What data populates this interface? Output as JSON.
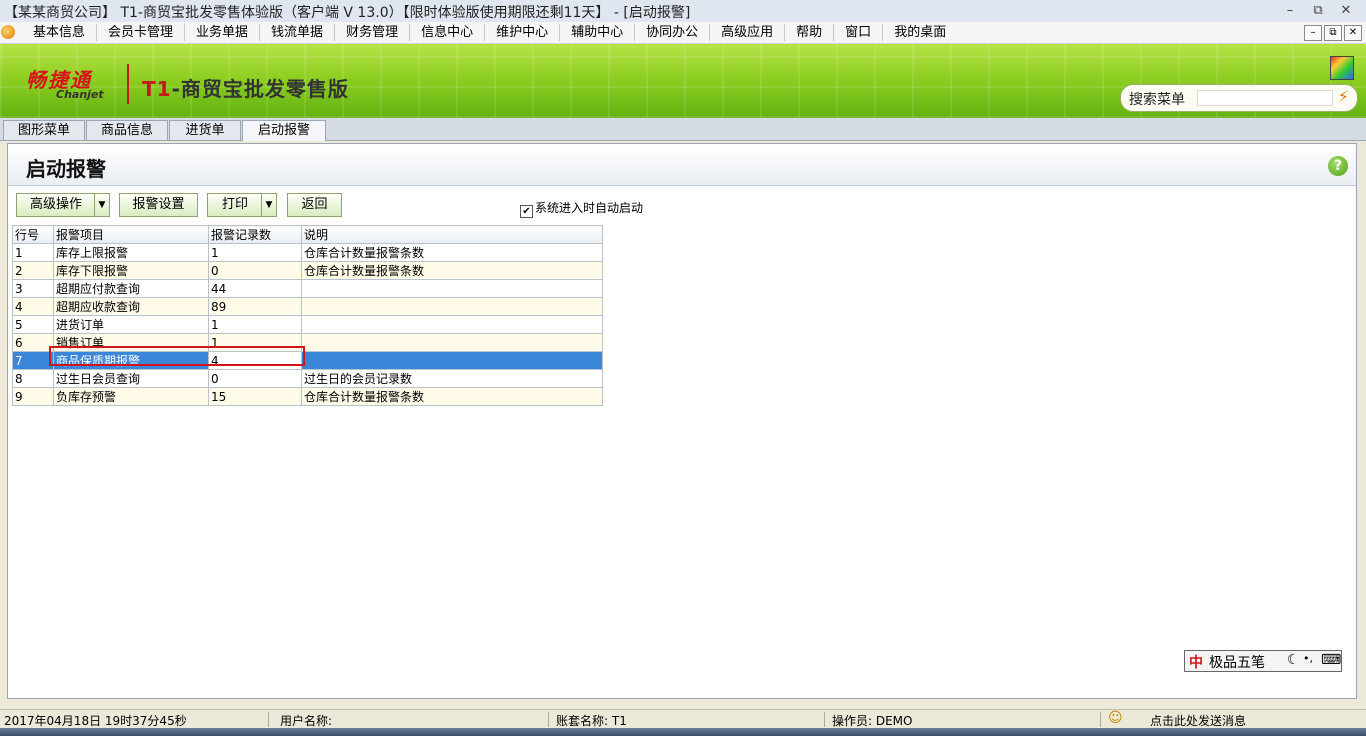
{
  "window": {
    "title": "【某某商贸公司】 T1-商贸宝批发零售体验版（客户端 V 13.0）【限时体验版使用期限还剩11天】 - [启动报警]",
    "min": "–",
    "restore": "⧉",
    "close": "✕"
  },
  "menu": {
    "items": [
      "基本信息",
      "会员卡管理",
      "业务单据",
      "钱流单据",
      "财务管理",
      "信息中心",
      "维护中心",
      "辅助中心",
      "协同办公",
      "高级应用",
      "帮助",
      "窗口",
      "我的桌面"
    ],
    "mdi": [
      "–",
      "⧉",
      "✕"
    ]
  },
  "banner": {
    "logo_cn": "畅捷通",
    "logo_en": "Chanjet",
    "product_t1": "T1",
    "product_rest": "-商贸宝批发零售版",
    "search_label": "搜索菜单",
    "search_value": ""
  },
  "tabs": [
    "图形菜单",
    "商品信息",
    "进货单",
    "启动报警"
  ],
  "page": {
    "title": "启动报警",
    "help": "?"
  },
  "toolbar": {
    "advanced": "高级操作",
    "alarm_settings": "报警设置",
    "print": "打印",
    "back": "返回",
    "auto_start_label": "系统进入时自动启动",
    "auto_start_checked": true,
    "check_mark": "✔",
    "dropdown_glyph": "▼"
  },
  "grid": {
    "columns": [
      "行号",
      "报警项目",
      "报警记录数",
      "说明"
    ],
    "rows": [
      [
        "1",
        "库存上限报警",
        "1",
        "仓库合计数量报警条数"
      ],
      [
        "2",
        "库存下限报警",
        "0",
        "仓库合计数量报警条数"
      ],
      [
        "3",
        "超期应付款查询",
        "44",
        ""
      ],
      [
        "4",
        "超期应收款查询",
        "89",
        ""
      ],
      [
        "5",
        "进货订单",
        "1",
        ""
      ],
      [
        "6",
        "销售订单",
        "1",
        ""
      ],
      [
        "7",
        "商品保质期报警",
        "4",
        ""
      ],
      [
        "8",
        "过生日会员查询",
        "0",
        "过生日的会员记录数"
      ],
      [
        "9",
        "负库存预警",
        "15",
        "仓库合计数量报警条数"
      ]
    ],
    "selected_row": 7
  },
  "ime": {
    "icon": "中",
    "name": "极品五笔",
    "moon": "☾",
    "punct": "•,",
    "kbd": "⌨"
  },
  "status": {
    "datetime": "2017年04月18日  19时37分45秒",
    "user_label": "用户名称:",
    "account_label": "账套名称: T1",
    "operator_label": "操作员: DEMO",
    "smiley": "☺",
    "message": "点击此处发送消息"
  }
}
